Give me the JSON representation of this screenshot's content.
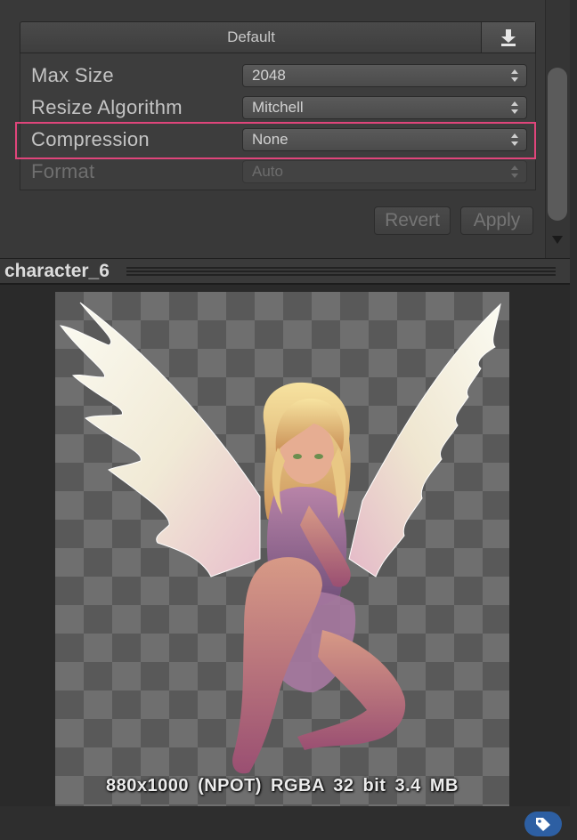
{
  "platform": {
    "tab_label": "Default",
    "download_icon": "download-icon"
  },
  "settings": [
    {
      "label": "Max Size",
      "value": "2048",
      "enabled": true
    },
    {
      "label": "Resize Algorithm",
      "value": "Mitchell",
      "enabled": true
    },
    {
      "label": "Compression",
      "value": "None",
      "enabled": true,
      "highlighted": true
    },
    {
      "label": "Format",
      "value": "Auto",
      "enabled": false
    }
  ],
  "buttons": {
    "revert": "Revert",
    "apply": "Apply"
  },
  "preview": {
    "title": "character_6",
    "info": "880x1000 (NPOT)  RGBA 32 bit   3.4 MB",
    "badge_icon": "tag-icon"
  },
  "colors": {
    "highlight": "#e0457b",
    "badge": "#2d5fa3"
  }
}
